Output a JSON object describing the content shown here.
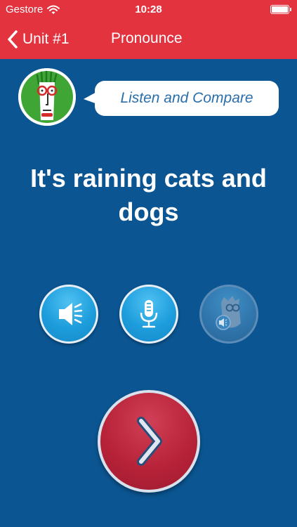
{
  "status_bar": {
    "carrier": "Gestore",
    "time": "10:28",
    "wifi_icon": "wifi-icon",
    "battery_icon": "battery-full-icon"
  },
  "nav": {
    "back_label": "Unit #1",
    "title": "Pronounce",
    "back_icon": "chevron-left-icon"
  },
  "tutor": {
    "avatar_icon": "cartoon-tutor-avatar",
    "instruction": "Listen and Compare"
  },
  "phrase": "It's raining cats and dogs",
  "controls": [
    {
      "name": "listen",
      "icon": "speaker-icon",
      "enabled": true
    },
    {
      "name": "record",
      "icon": "microphone-icon",
      "enabled": true
    },
    {
      "name": "compare",
      "icon": "tutor-speaker-icon",
      "enabled": false
    }
  ],
  "next": {
    "icon": "chevron-right-icon"
  },
  "colors": {
    "header": "#e2333f",
    "background": "#0b5592",
    "control_button": "#1d9ddc",
    "next_button": "#b82339",
    "bubble_text": "#2a6eaa"
  }
}
